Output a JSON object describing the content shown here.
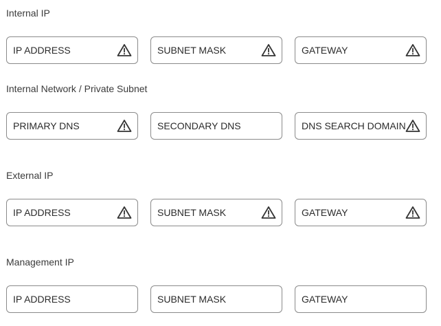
{
  "sections": [
    {
      "title": "Internal IP",
      "fields": [
        {
          "label": "IP ADDRESS",
          "warning": true,
          "icon": "warning-icon"
        },
        {
          "label": "SUBNET MASK",
          "warning": true,
          "icon": "warning-icon"
        },
        {
          "label": "GATEWAY",
          "warning": true,
          "icon": "warning-icon"
        }
      ]
    },
    {
      "title": "Internal Network / Private Subnet",
      "fields": [
        {
          "label": "PRIMARY DNS",
          "warning": true,
          "icon": "warning-icon"
        },
        {
          "label": "SECONDARY DNS",
          "warning": false
        },
        {
          "label": "DNS SEARCH DOMAIN",
          "warning": true,
          "icon": "warning-icon"
        }
      ]
    },
    {
      "title": "External IP",
      "fields": [
        {
          "label": "IP ADDRESS",
          "warning": true,
          "icon": "warning-icon"
        },
        {
          "label": "SUBNET MASK",
          "warning": true,
          "icon": "warning-icon"
        },
        {
          "label": "GATEWAY",
          "warning": true,
          "icon": "warning-icon"
        }
      ]
    },
    {
      "title": "Management IP",
      "fields": [
        {
          "label": "IP ADDRESS",
          "warning": false
        },
        {
          "label": "SUBNET MASK",
          "warning": false
        },
        {
          "label": "GATEWAY",
          "warning": false
        }
      ]
    }
  ],
  "colors": {
    "border": "#8a8a8a",
    "warning_icon": "#333333"
  }
}
